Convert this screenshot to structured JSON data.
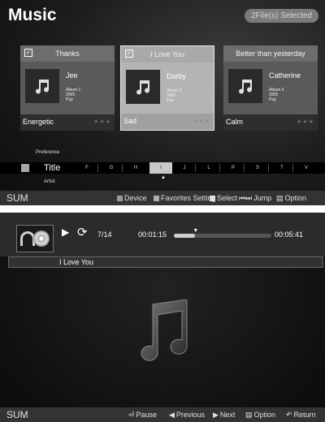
{
  "library": {
    "title": "Music",
    "selection_badge": "2File(s) Selected",
    "cards": [
      {
        "title": "Thanks",
        "checked": true,
        "artist": "Jee",
        "meta": [
          "Album 1",
          "2005",
          "Pop"
        ],
        "mood": "Energetic",
        "stars": "★★★"
      },
      {
        "title": "I Love You",
        "checked": true,
        "artist": "Darby",
        "meta": [
          "Album 2",
          "2005",
          "Pop"
        ],
        "mood": "Sad",
        "stars": "★★★"
      },
      {
        "title": "Better than yesterday",
        "checked": false,
        "artist": "Catherine",
        "meta": [
          "Album 3",
          "2005",
          "Pop"
        ],
        "mood": "Calm",
        "stars": "★★★"
      }
    ],
    "sort": {
      "above": "Preference",
      "current": "Title",
      "below": "Artist",
      "letters": [
        "F",
        "G",
        "H",
        "I",
        "J",
        "L",
        "P",
        "S",
        "T",
        "V"
      ]
    },
    "footer": {
      "sum": "SUM",
      "device": "Device",
      "favorites": "Favorites Setting",
      "select": "Select",
      "jump": "Jump",
      "option": "Option"
    }
  },
  "player": {
    "track_index": "7/14",
    "elapsed": "00:01:15",
    "total": "00:05:41",
    "progress": 0.22,
    "song_title": "I Love You",
    "footer": {
      "sum": "SUM",
      "pause": "Pause",
      "previous": "Previous",
      "next": "Next",
      "option": "Option",
      "return": "Return"
    }
  },
  "colors": {
    "selected_card": "#cfcfcf",
    "panel_bg": "#1a1a1a",
    "bottom_bar": "#333333"
  }
}
